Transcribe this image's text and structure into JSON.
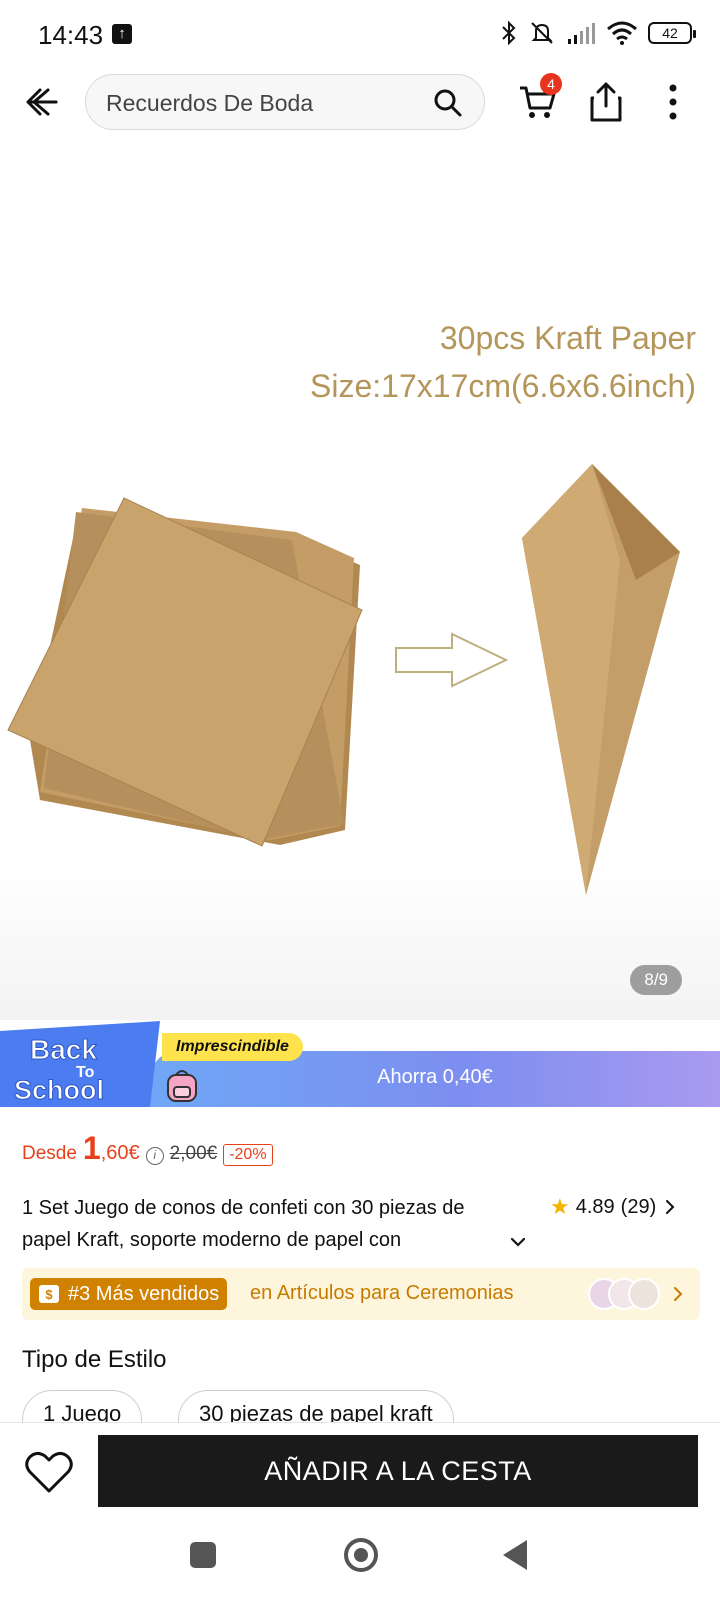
{
  "status_bar": {
    "time": "14:43",
    "battery": "42"
  },
  "header": {
    "search_text": "Recuerdos De Boda",
    "cart_count": "4"
  },
  "product_image": {
    "caption_line1": "30pcs Kraft Paper",
    "caption_line2": "Size:17x17cm(6.6x6.6inch)",
    "counter": "8/9"
  },
  "promo": {
    "logo_line1": "Back",
    "logo_line2": "To",
    "logo_line3": "School",
    "tag": "Imprescindible",
    "savings": "Ahorra 0,40€"
  },
  "price": {
    "from_label": "Desde",
    "integer": "1",
    "decimal": ",60€",
    "original": "2,00€",
    "discount": "-20%"
  },
  "product": {
    "title": "1 Set Juego de conos de confeti con 30 piezas de papel Kraft, soporte moderno de papel con",
    "rating": "4.89",
    "reviews": "(29)"
  },
  "bestseller": {
    "badge": "#3 Más vendidos",
    "category": "en Artículos para Ceremonias"
  },
  "style": {
    "title": "Tipo de Estilo",
    "options": [
      "1 Juego",
      "30 piezas de papel kraft"
    ]
  },
  "actions": {
    "add_to_cart": "AÑADIR A LA CESTA"
  },
  "colors": {
    "accent": "#e8401c",
    "button": "#1a1a1a",
    "bestseller": "#d18100",
    "promo_blue": "#6fa7f6"
  },
  "icons": [
    "back-arrow-icon",
    "search-icon",
    "cart-icon",
    "share-icon",
    "more-vertical-icon",
    "info-icon",
    "star-icon",
    "chevron-right-icon",
    "chevron-down-icon",
    "heart-icon"
  ]
}
